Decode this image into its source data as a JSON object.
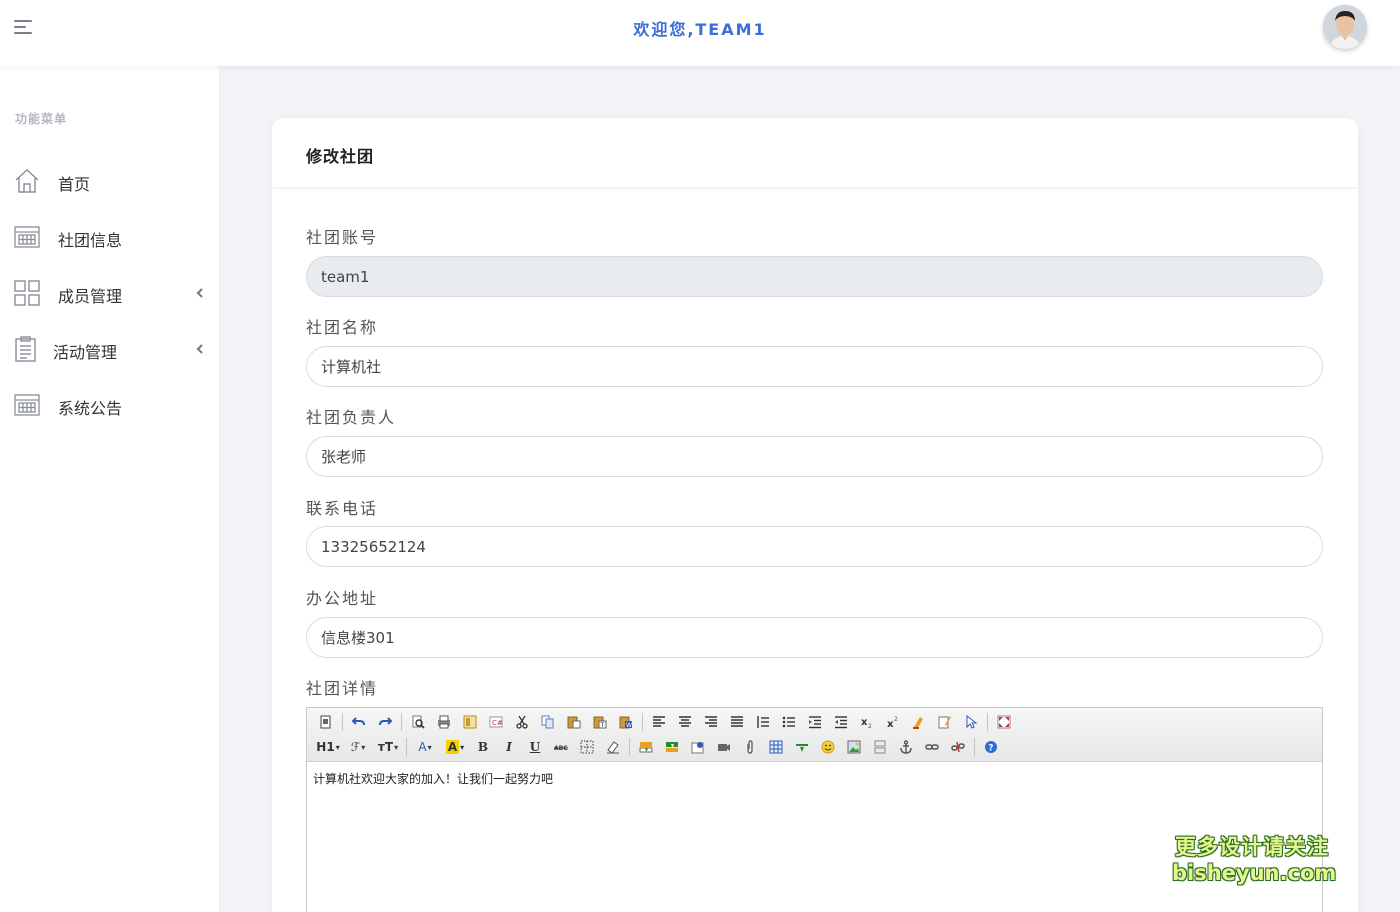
{
  "header": {
    "welcome": "欢迎您,TEAM1"
  },
  "sidebar": {
    "title": "功能菜单",
    "items": [
      {
        "label": "首页",
        "icon": "home-icon",
        "has_submenu": false
      },
      {
        "label": "社团信息",
        "icon": "calendar-icon",
        "has_submenu": false
      },
      {
        "label": "成员管理",
        "icon": "grid-icon",
        "has_submenu": true
      },
      {
        "label": "活动管理",
        "icon": "clipboard-icon",
        "has_submenu": true
      },
      {
        "label": "系统公告",
        "icon": "calendar-icon",
        "has_submenu": false
      }
    ]
  },
  "card": {
    "title": "修改社团"
  },
  "form": {
    "fields": [
      {
        "label": "社团账号",
        "value": "team1",
        "readonly": true
      },
      {
        "label": "社团名称",
        "value": "计算机社",
        "readonly": false
      },
      {
        "label": "社团负责人",
        "value": "张老师",
        "readonly": false
      },
      {
        "label": "联系电话",
        "value": "13325652124",
        "readonly": false
      },
      {
        "label": "办公地址",
        "value": "信息楼301",
        "readonly": false
      }
    ],
    "detail_label": "社团详情",
    "detail_content": "计算机社欢迎大家的加入！让我们一起努力吧"
  },
  "editor_toolbar": {
    "row2_text": {
      "heading": "H1",
      "font_family": "ℱ",
      "font_size": "тT",
      "font_color": "A",
      "bg_color": "A",
      "bold": "B",
      "italic": "I",
      "underline": "U"
    }
  },
  "watermark": {
    "line1": "更多设计请关注",
    "line2": "bisheyun.com"
  },
  "colors": {
    "accent": "#3b6fd6",
    "page_bg": "#f3f4f8",
    "readonly_bg": "#e9ecef"
  }
}
